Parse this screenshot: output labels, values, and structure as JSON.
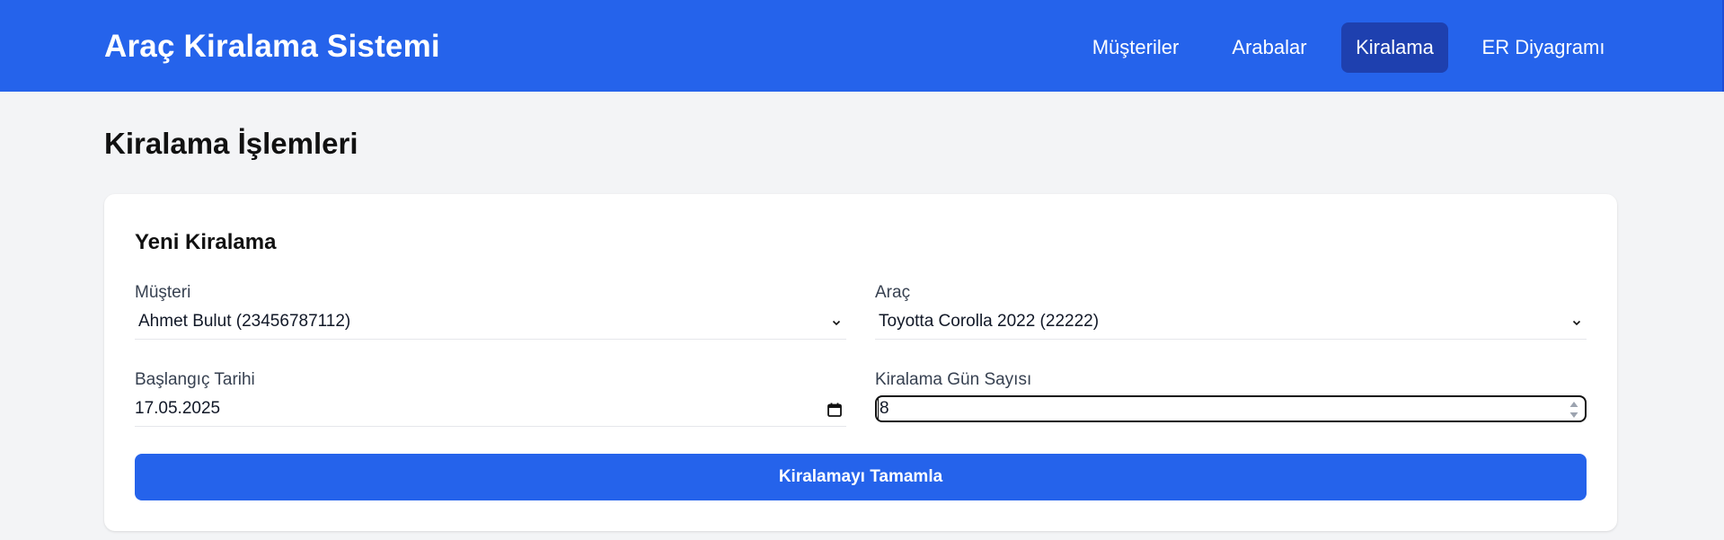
{
  "header": {
    "brand": "Araç Kiralama Sistemi",
    "nav": [
      {
        "label": "Müşteriler",
        "active": false
      },
      {
        "label": "Arabalar",
        "active": false
      },
      {
        "label": "Kiralama",
        "active": true
      },
      {
        "label": "ER Diyagramı",
        "active": false
      }
    ],
    "colors": {
      "background": "#2563eb",
      "active_item": "#1e40af"
    }
  },
  "page": {
    "title": "Kiralama İşlemleri"
  },
  "form": {
    "title": "Yeni Kiralama",
    "customer": {
      "label": "Müşteri",
      "value": "Ahmet Bulut (23456787112)"
    },
    "vehicle": {
      "label": "Araç",
      "value": "Toyotta Corolla 2022 (22222)"
    },
    "start_date": {
      "label": "Başlangıç Tarihi",
      "value": "17.05.2025"
    },
    "days": {
      "label": "Kiralama Gün Sayısı",
      "value": "8"
    },
    "submit_label": "Kiralamayı Tamamla"
  },
  "icons": {
    "select_arrow": "chevron-down-icon",
    "date_picker": "calendar-icon",
    "number_spinner": "spinner-arrows-icon"
  }
}
